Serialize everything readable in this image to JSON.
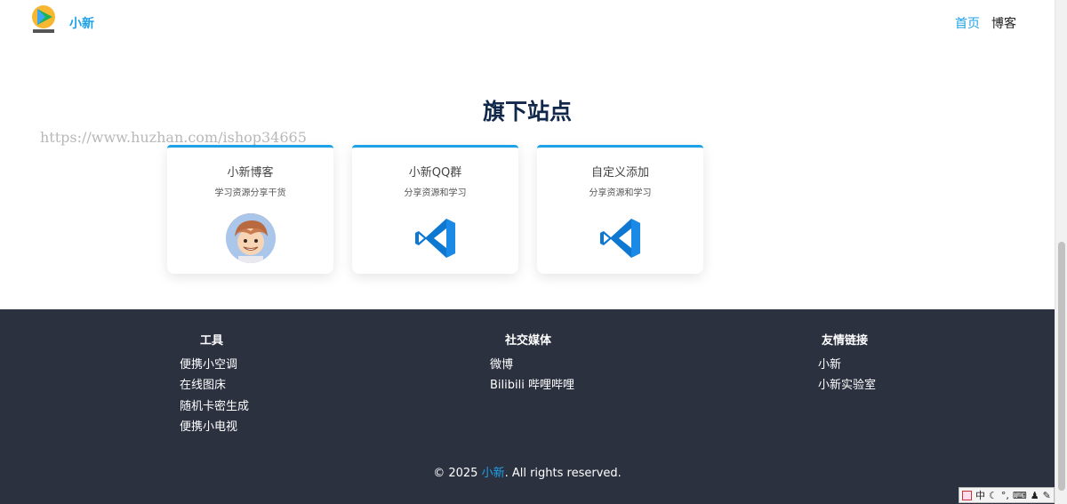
{
  "header": {
    "brand": "小新",
    "nav": {
      "home": "首页",
      "blog": "博客"
    }
  },
  "section": {
    "title": "旗下站点",
    "watermark": "https://www.huzhan.com/ishop34665"
  },
  "cards": [
    {
      "title": "小新博客",
      "desc": "学习资源分享干货",
      "icon": "avatar"
    },
    {
      "title": "小新QQ群",
      "desc": "分享资源和学习",
      "icon": "vscode-icon"
    },
    {
      "title": "自定义添加",
      "desc": "分享资源和学习",
      "icon": "vscode-icon"
    }
  ],
  "footer": {
    "columns": [
      {
        "title": "工具",
        "links": [
          "便携小空调",
          "在线图床",
          "随机卡密生成",
          "便携小电视"
        ]
      },
      {
        "title": "社交媒体",
        "links": [
          "微博",
          "Bilibili 哔哩哔哩"
        ]
      },
      {
        "title": "友情链接",
        "links": [
          "小新",
          "小新实验室"
        ]
      }
    ],
    "copyright": {
      "prefix": "© 2025 ",
      "name": "小新",
      "suffix": ". All rights reserved."
    }
  },
  "ime": {
    "mode": "中"
  },
  "colors": {
    "accent": "#1ea1e8",
    "footer_bg": "#2c3140",
    "title": "#12284a"
  }
}
